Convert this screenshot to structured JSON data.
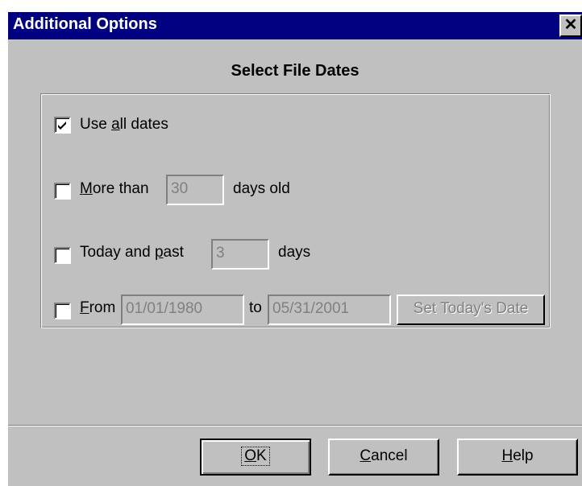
{
  "window": {
    "title": "Additional Options",
    "close_glyph": "✕"
  },
  "heading": "Select File Dates",
  "options": {
    "all": {
      "checked": true,
      "label_pre": "Use ",
      "label_accel": "a",
      "label_post": "ll dates"
    },
    "more_than": {
      "checked": false,
      "label_accel": "M",
      "label_post": "ore than",
      "value": "30",
      "suffix": "days old"
    },
    "today_past": {
      "checked": false,
      "label_pre": "Today and ",
      "label_accel": "p",
      "label_post": "ast",
      "value": "3",
      "suffix": "days"
    },
    "from": {
      "checked": false,
      "label_accel": "F",
      "label_post": "rom",
      "from_value": "01/01/1980",
      "to_label": "to",
      "to_value": "05/31/2001",
      "set_today_label": "Set Today's Date"
    }
  },
  "buttons": {
    "ok": {
      "accel": "O",
      "rest": "K"
    },
    "cancel": {
      "accel": "C",
      "rest": "ancel"
    },
    "help": {
      "accel": "H",
      "rest": "elp"
    }
  },
  "icons": {
    "checkmark": "check-icon",
    "close": "close-icon"
  },
  "colors": {
    "titlebar": "#000080",
    "face": "#c0c0c0",
    "disabled_text": "#808080"
  }
}
